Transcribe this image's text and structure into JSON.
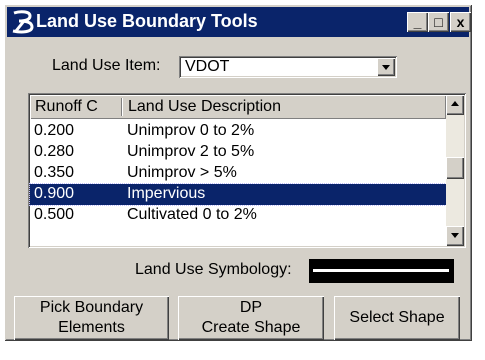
{
  "window": {
    "title": "Land Use Boundary Tools",
    "minimize_glyph": "_",
    "maximize_glyph": "□",
    "close_glyph": "x"
  },
  "land_use_item": {
    "label": "Land Use Item:",
    "value": "VDOT"
  },
  "table": {
    "columns": [
      "Runoff C",
      "Land Use Description"
    ],
    "rows": [
      {
        "runoff": "0.200",
        "description": "Unimprov 0 to 2%",
        "selected": false
      },
      {
        "runoff": "0.280",
        "description": "Unimprov 2 to 5%",
        "selected": false
      },
      {
        "runoff": "0.350",
        "description": "Unimprov > 5%",
        "selected": false
      },
      {
        "runoff": "0.900",
        "description": "Impervious",
        "selected": true
      },
      {
        "runoff": "0.500",
        "description": "Cultivated 0 to 2%",
        "selected": false
      }
    ]
  },
  "symbology": {
    "label": "Land Use Symbology:"
  },
  "buttons": {
    "pick_boundary": [
      "Pick Boundary",
      "Elements"
    ],
    "dp_create": [
      "DP",
      "Create Shape"
    ],
    "select_shape": "Select Shape"
  },
  "colors": {
    "titlebar": "#0a246a",
    "selection": "#0a246a",
    "face": "#d4d0c8"
  },
  "icons": {
    "app": "bentley-b-icon"
  }
}
